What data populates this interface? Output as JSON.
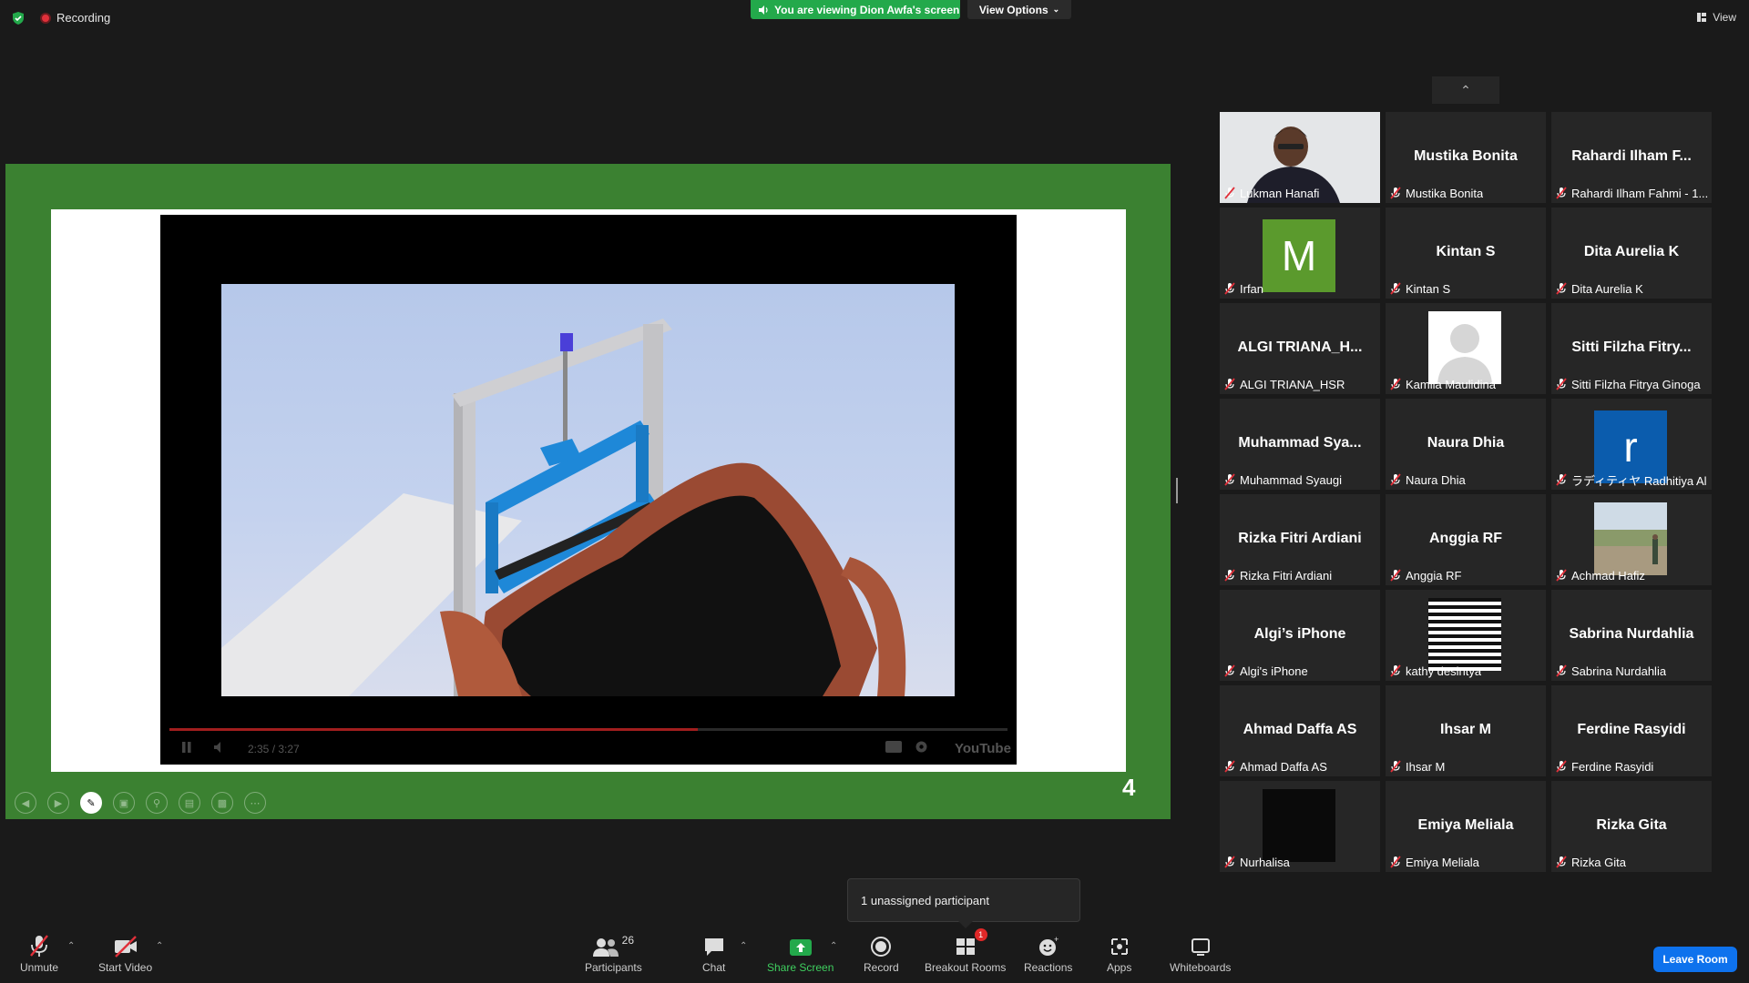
{
  "topbar": {
    "recording_label": "Recording",
    "viewing_label": "You are viewing Dion Awfa's screen",
    "view_options_label": "View Options",
    "view_label": "View"
  },
  "player": {
    "time": "2:35 / 3:27",
    "progress_fraction": 0.63,
    "logo": "YouTube"
  },
  "slide": {
    "number": "4"
  },
  "gallery": {
    "tiles": [
      {
        "title": "",
        "label": "Lukman Hanafi",
        "kind": "video"
      },
      {
        "title": "Mustika Bonita",
        "label": "Mustika Bonita",
        "kind": "name"
      },
      {
        "title": "Rahardi  Ilham  F...",
        "label": "Rahardi Ilham Fahmi - 1...",
        "kind": "name"
      },
      {
        "title": "M",
        "label": "Irfan",
        "kind": "letter",
        "color": "#5b9a2d"
      },
      {
        "title": "Kintan S",
        "label": "Kintan S",
        "kind": "name"
      },
      {
        "title": "Dita Aurelia K",
        "label": "Dita Aurelia K",
        "kind": "name"
      },
      {
        "title": "ALGI TRIANA_H...",
        "label": "ALGI TRIANA_HSR",
        "kind": "name"
      },
      {
        "title": "",
        "label": "Kamila Maulidina",
        "kind": "silhouette"
      },
      {
        "title": "Sitti  Filzha  Fitry...",
        "label": "Sitti Filzha Fitrya Ginoga",
        "kind": "name"
      },
      {
        "title": "Muhammad  Sya...",
        "label": "Muhammad Syaugi",
        "kind": "name"
      },
      {
        "title": "Naura Dhia",
        "label": "Naura Dhia",
        "kind": "name"
      },
      {
        "title": "r",
        "label": "ラディティヤ Radhitiya Al ...",
        "kind": "letter",
        "color": "#0b5cad"
      },
      {
        "title": "Rizka Fitri Ardiani",
        "label": "Rizka Fitri Ardiani",
        "kind": "name"
      },
      {
        "title": "Anggia RF",
        "label": "Anggia RF",
        "kind": "name"
      },
      {
        "title": "",
        "label": "Achmad Hafiz",
        "kind": "photo"
      },
      {
        "title": "Algi’s iPhone",
        "label": "Algi's iPhone",
        "kind": "name"
      },
      {
        "title": "",
        "label": "kathy desintya",
        "kind": "stripes"
      },
      {
        "title": "Sabrina Nurdahlia",
        "label": "Sabrina Nurdahlia",
        "kind": "name"
      },
      {
        "title": "Ahmad Daffa AS",
        "label": "Ahmad Daffa AS",
        "kind": "name"
      },
      {
        "title": "Ihsar M",
        "label": "Ihsar M",
        "kind": "name"
      },
      {
        "title": "Ferdine Rasyidi",
        "label": "Ferdine Rasyidi",
        "kind": "name"
      },
      {
        "title": "",
        "label": "Nurhalisa",
        "kind": "black"
      },
      {
        "title": "Emiya Meliala",
        "label": "Emiya Meliala",
        "kind": "name"
      },
      {
        "title": "Rizka Gita",
        "label": "Rizka Gita",
        "kind": "name"
      }
    ]
  },
  "popup": {
    "text": "1 unassigned participant"
  },
  "toolbar": {
    "unmute": "Unmute",
    "start_video": "Start Video",
    "participants": "Participants",
    "participants_count": "26",
    "chat": "Chat",
    "share_screen": "Share Screen",
    "record": "Record",
    "breakout_rooms": "Breakout Rooms",
    "breakout_badge": "1",
    "reactions": "Reactions",
    "apps": "Apps",
    "whiteboards": "Whiteboards",
    "leave_room": "Leave Room"
  },
  "colors": {
    "stage_green": "#3b8131",
    "viewing_green": "#23a94b",
    "leave_blue": "#0e72ed",
    "muted_red": "#e0303a"
  }
}
